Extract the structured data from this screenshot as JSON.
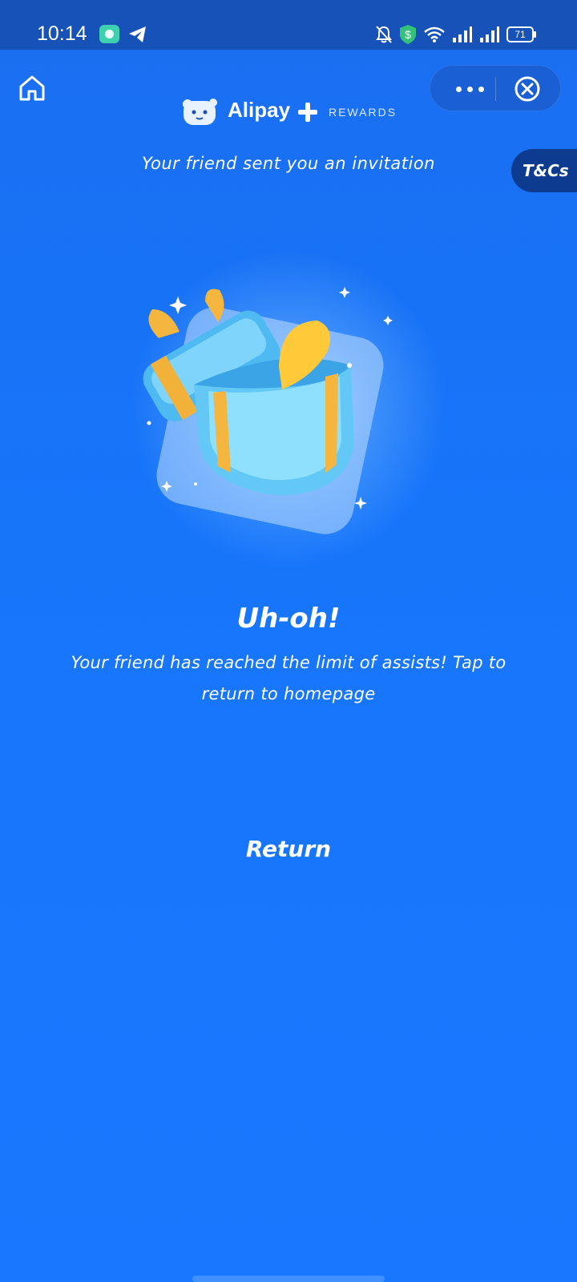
{
  "status_bar": {
    "time": "10:14",
    "battery": "71",
    "icons": [
      "app-notification-icon",
      "telegram-icon",
      "mute-bell-icon",
      "shield-dollar-icon",
      "wifi-icon",
      "signal-icon",
      "signal-icon",
      "battery-icon"
    ]
  },
  "nav": {
    "home_icon": "home-icon",
    "more_icon": "more-dots-icon",
    "close_icon": "close-circle-icon"
  },
  "brand": {
    "name": "Alipay",
    "rewards": "REWARDS"
  },
  "page": {
    "subtitle": "Your friend sent you an invitation",
    "tcs_label": "T&Cs",
    "headline": "Uh-oh!",
    "message": "Your friend has reached the limit of assists! Tap to return to homepage",
    "return_label": "Return"
  },
  "colors": {
    "background": "#1778ff",
    "status_bar": "#1652b8",
    "tcs_tab": "#0c3b8f",
    "gift_box": "#5ec8f7",
    "ribbon": "#f5b63f"
  }
}
